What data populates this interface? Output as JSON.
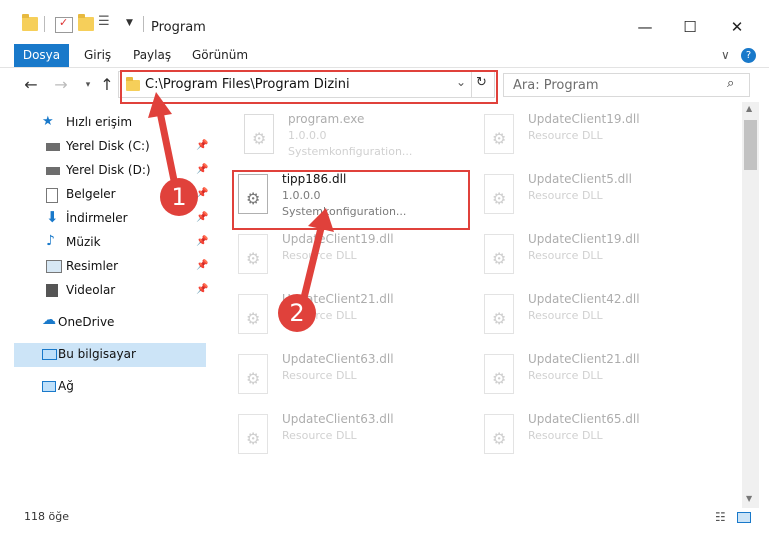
{
  "window": {
    "title": "Program",
    "min_label": "—",
    "max_label": "☐",
    "close_label": "✕"
  },
  "ribbon": {
    "tabs": [
      "Dosya",
      "Giriş",
      "Paylaş",
      "Görünüm"
    ],
    "expand_label": "∨",
    "help_label": "?"
  },
  "nav": {
    "address": "C:\\Program Files\\Program Dizini",
    "search_placeholder": "Ara: Program"
  },
  "sidebar": {
    "items": [
      {
        "label": "Hızlı erişim",
        "icon": "star-icon"
      },
      {
        "label": "Yerel Disk (C:)",
        "icon": "drive-icon"
      },
      {
        "label": "Yerel Disk (D:)",
        "icon": "drive-icon"
      },
      {
        "label": "Belgeler",
        "icon": "documents-icon"
      },
      {
        "label": "İndirmeler",
        "icon": "download-icon"
      },
      {
        "label": "Müzik",
        "icon": "music-icon"
      },
      {
        "label": "Resimler",
        "icon": "pictures-icon"
      },
      {
        "label": "Videolar",
        "icon": "video-icon"
      },
      {
        "label": "OneDrive",
        "icon": "cloud-icon"
      },
      {
        "label": "Bu bilgisayar",
        "icon": "computer-icon"
      },
      {
        "label": "Ağ",
        "icon": "network-icon"
      }
    ]
  },
  "files": {
    "left": [
      {
        "name": "program.exe",
        "version": "1.0.0.0",
        "desc": "Systemkonfiguration..."
      },
      {
        "name": "tipp186.dll",
        "version": "1.0.0.0",
        "desc": "Systemkonfiguration..."
      },
      {
        "name": "UpdateClient19.dll",
        "desc": "Resource DLL"
      },
      {
        "name": "UpdateClient21.dll",
        "desc": "Resource DLL"
      },
      {
        "name": "UpdateClient63.dll",
        "desc": "Resource DLL"
      },
      {
        "name": "UpdateClient63.dll",
        "desc": "Resource DLL"
      }
    ],
    "right": [
      {
        "name": "UpdateClient19.dll",
        "desc": "Resource DLL"
      },
      {
        "name": "UpdateClient5.dll",
        "desc": "Resource DLL"
      },
      {
        "name": "UpdateClient19.dll",
        "desc": "Resource DLL"
      },
      {
        "name": "UpdateClient42.dll",
        "desc": "Resource DLL"
      },
      {
        "name": "UpdateClient21.dll",
        "desc": "Resource DLL"
      },
      {
        "name": "UpdateClient65.dll",
        "desc": "Resource DLL"
      }
    ]
  },
  "status": {
    "item_count": "118 öğe"
  },
  "annotations": {
    "badge1": "1",
    "badge2": "2",
    "color": "#e0413b"
  }
}
